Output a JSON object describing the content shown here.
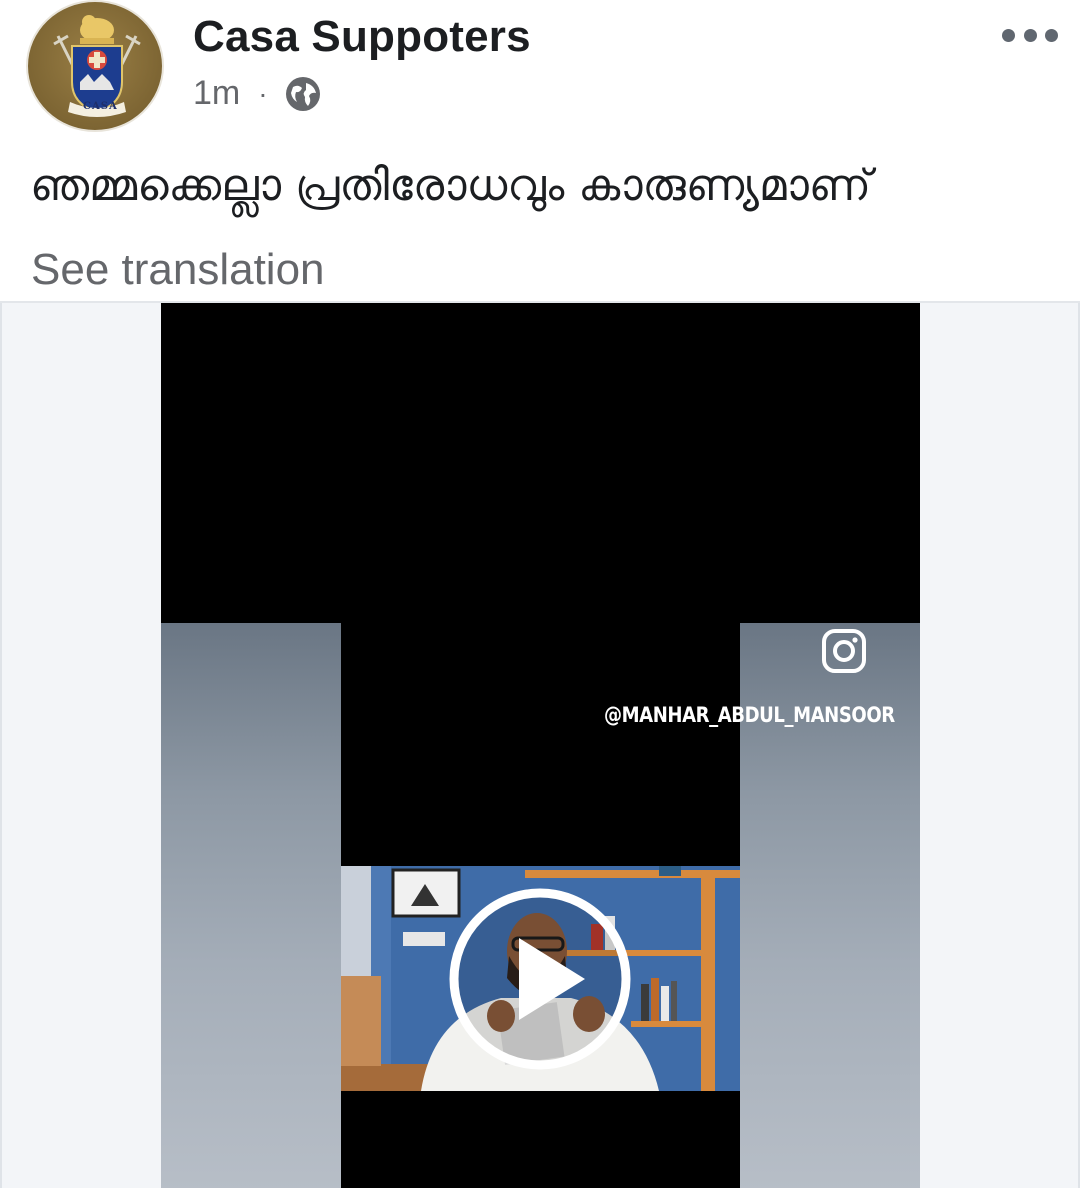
{
  "header": {
    "page_name": "Casa Suppoters",
    "time": "1m",
    "separator": "·",
    "privacy_icon": "globe-icon",
    "more_icon": "more-horizontal-icon",
    "avatar_text": "CASA"
  },
  "post": {
    "text": "ഞമ്മക്കെല്ലാ പ്രതിരോധവും കാരുണ്യമാണ്",
    "see_translation": "See translation"
  },
  "video": {
    "watermark_icon": "instagram-icon",
    "watermark_handle": "@MANHAR_ABDUL_MANSOOR",
    "play_icon": "play-icon"
  },
  "colors": {
    "name": "#1c1e21",
    "meta": "#65676b",
    "media_bg": "#f3f5f8",
    "video_bg": "#000000"
  }
}
